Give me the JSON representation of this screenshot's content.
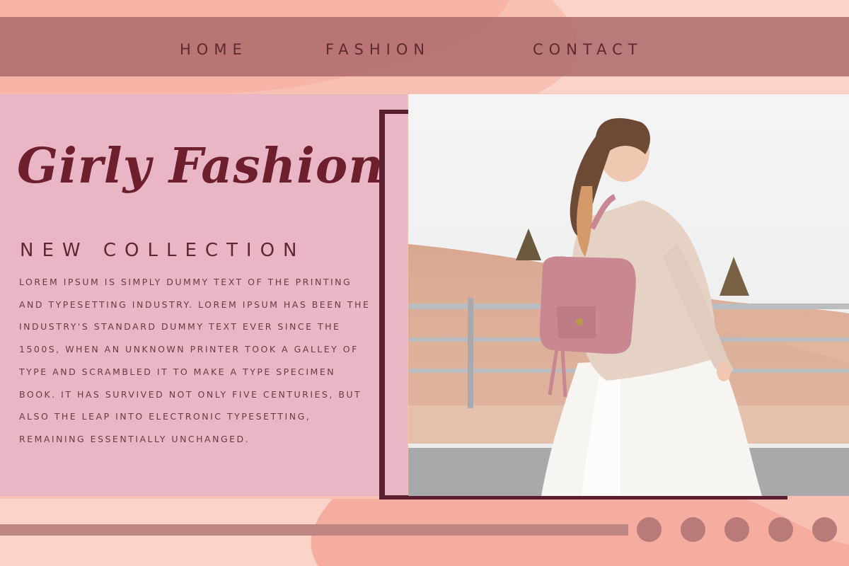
{
  "nav": {
    "home_label": "HOME",
    "fashion_label": "FASHION",
    "contact_label": "CONTACT"
  },
  "hero": {
    "title": "Girly Fashion",
    "subtitle": "NEW COLLECTION",
    "body": "Lorem Ipsum is simply dummy text of the printing and typesetting industry. Lorem Ipsum has been the industry's standard dummy text ever since the 1500s, when an unknown printer took a galley of type and scrambled it to make a type specimen book. It has survived not only five centuries, but also the leap into electronic typesetting, remaining essentially unchanged."
  },
  "photo": {
    "subject": "woman in beige sweater and white tulle skirt with pink backpack"
  },
  "carousel": {
    "dot_count": 5
  },
  "colors": {
    "background": "#f9c6b9",
    "nav_band": "#aa6868",
    "panel": "#e8b6c5",
    "accent": "#5c1f30",
    "title_text": "#6e1f2e",
    "dots": "#b97b7a"
  }
}
